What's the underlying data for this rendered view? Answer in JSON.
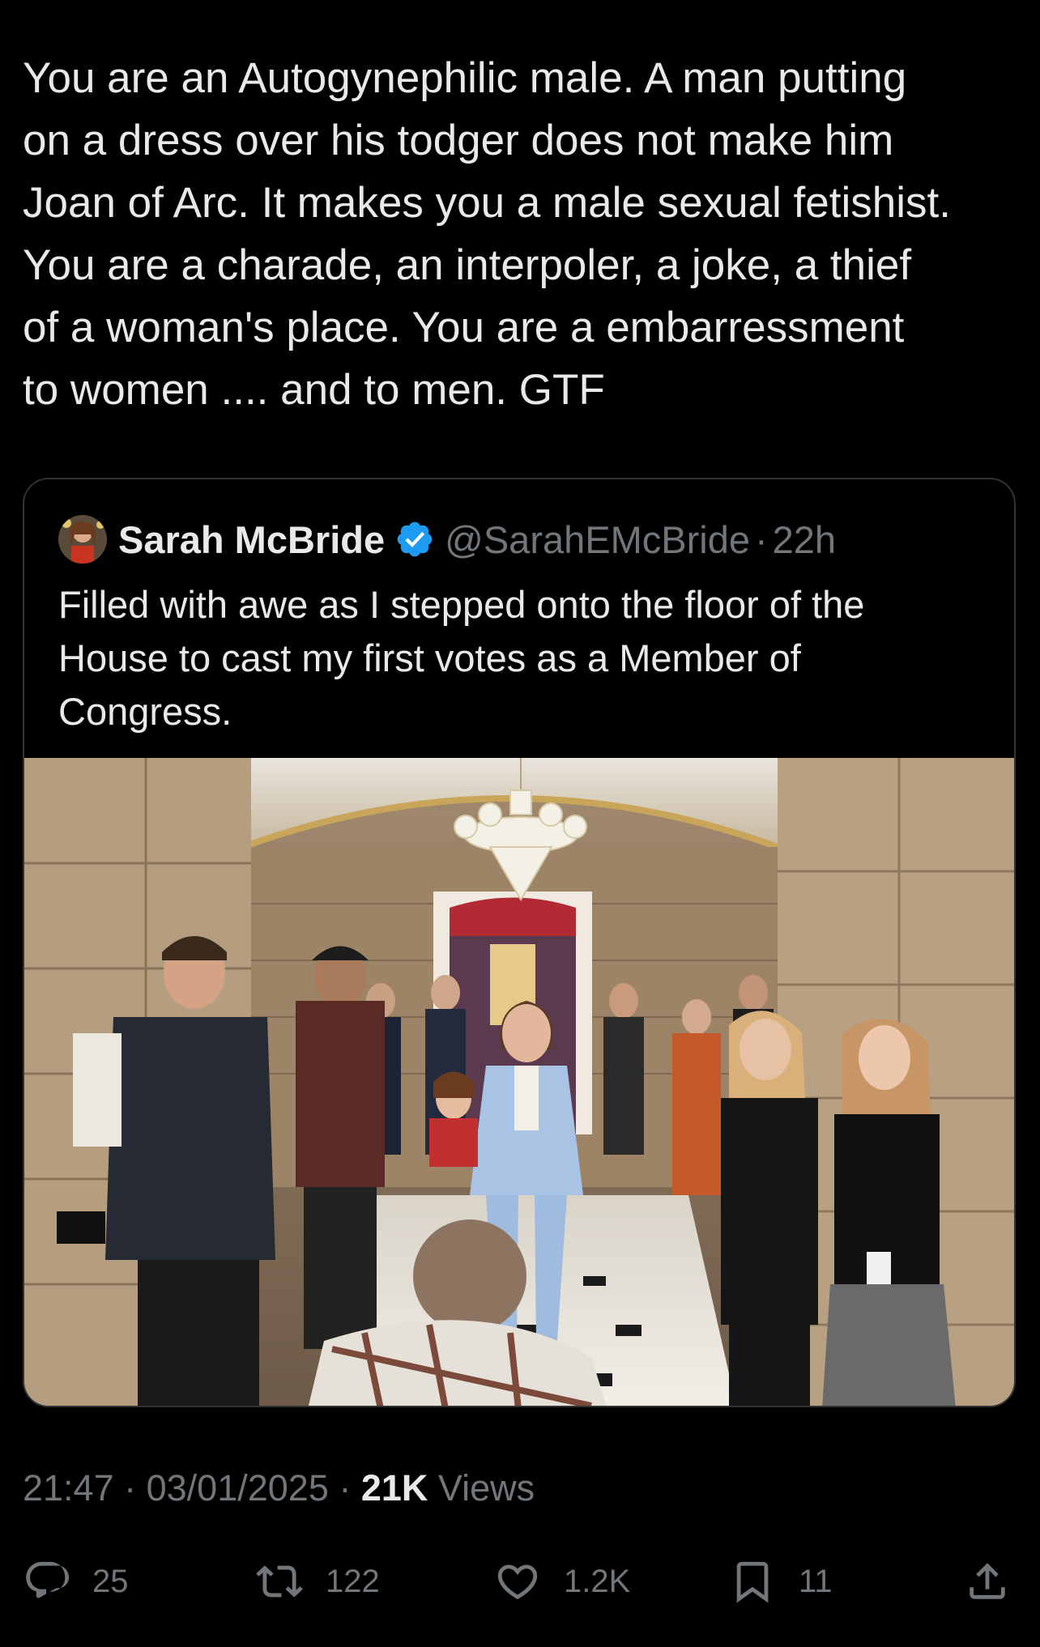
{
  "tweet": {
    "text": "You are an Autogynephilic male. A man putting\non a dress over his todger does not make him\nJoan of Arc. It makes you a male sexual fetishist.\nYou are a charade, an interpoler, a joke, a thief\nof a woman's place. You are a embarressment\nto women .... and to men. GTF"
  },
  "quote": {
    "name": "Sarah McBride",
    "handle": "@SarahEMcBride",
    "separator": "·",
    "time": "22h",
    "text": "Filled with awe as I stepped onto the floor of the\nHouse to cast my first votes as a Member of\nCongress.",
    "photo_icon": "photo-capitol-hallway"
  },
  "meta": {
    "time": "21:47",
    "sep1": " · ",
    "date": "03/01/2025",
    "sep2": " · ",
    "views_count": "21K",
    "views_label": " Views"
  },
  "actions": {
    "replies": "25",
    "reposts": "122",
    "likes": "1.2K",
    "bookmarks": "11",
    "icons": [
      "reply-icon",
      "repost-icon",
      "like-icon",
      "bookmark-icon",
      "share-icon"
    ]
  },
  "colors": {
    "background": "#000000",
    "text": "#e7e9ea",
    "muted": "#71767b",
    "border": "#2f3336",
    "verified": "#1d9bf0"
  }
}
